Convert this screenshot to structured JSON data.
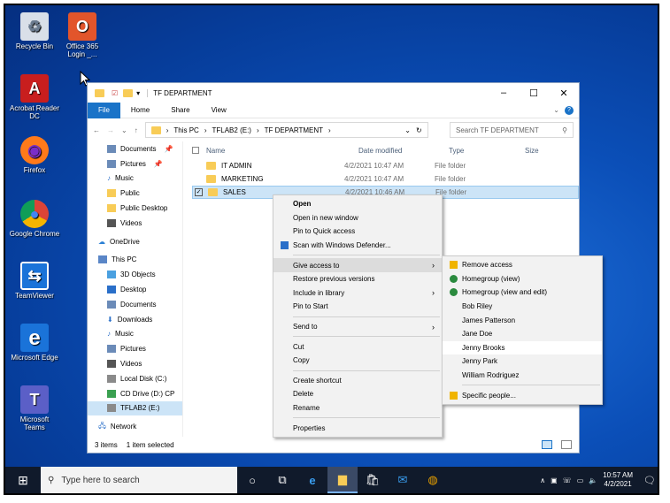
{
  "desktop": {
    "icons": [
      {
        "label": "Recycle Bin",
        "glyph": "♻",
        "bg": "#d9dfe8",
        "fg": "#6b7b8f"
      },
      {
        "label": "Office 365 Login _...",
        "glyph": "O",
        "bg": "#e2552b",
        "fg": "#ffffff"
      },
      {
        "label": "Acrobat Reader DC",
        "glyph": "A",
        "bg": "#c81e1e",
        "fg": "#ffffff"
      },
      {
        "label": "Firefox",
        "glyph": "◉",
        "bg": "#ff7a1a",
        "fg": "#7a2dc8"
      },
      {
        "label": "Google Chrome",
        "glyph": "◍",
        "bg": "#ffffff",
        "fg": "#2a8a3e"
      },
      {
        "label": "TeamViewer",
        "glyph": "⇆",
        "bg": "#1a73d9",
        "fg": "#ffffff"
      },
      {
        "label": "Microsoft Edge",
        "glyph": "e",
        "bg": "#1a73d9",
        "fg": "#ffffff"
      },
      {
        "label": "Microsoft Teams",
        "glyph": "T",
        "bg": "#5b5fc7",
        "fg": "#ffffff"
      }
    ]
  },
  "explorer": {
    "title": "TF DEPARTMENT",
    "ribbon": {
      "file": "File",
      "home": "Home",
      "share": "Share",
      "view": "View"
    },
    "address": {
      "this_pc": "This PC",
      "drive": "TFLAB2 (E:)",
      "folder": "TF DEPARTMENT"
    },
    "search_placeholder": "Search TF DEPARTMENT",
    "nav": [
      {
        "label": "Documents",
        "color": "#6b8bb8"
      },
      {
        "label": "Pictures",
        "color": "#6b8bb8"
      },
      {
        "label": "Music",
        "color": "#2a6fc9"
      },
      {
        "label": "Public",
        "color": "#f8cc57"
      },
      {
        "label": "Public Desktop",
        "color": "#f8cc57"
      },
      {
        "label": "Videos",
        "color": "#555555"
      },
      {
        "label": "OneDrive",
        "color": "#2a7fd4"
      },
      {
        "label": "This PC",
        "color": "#5a86c7"
      },
      {
        "label": "3D Objects",
        "color": "#4aa0e0"
      },
      {
        "label": "Desktop",
        "color": "#2a6fc9"
      },
      {
        "label": "Documents",
        "color": "#6b8bb8"
      },
      {
        "label": "Downloads",
        "color": "#2a6fc9"
      },
      {
        "label": "Music",
        "color": "#2a6fc9"
      },
      {
        "label": "Pictures",
        "color": "#6b8bb8"
      },
      {
        "label": "Videos",
        "color": "#555555"
      },
      {
        "label": "Local Disk (C:)",
        "color": "#8a8a8a"
      },
      {
        "label": "CD Drive (D:) CP",
        "color": "#3aa050"
      },
      {
        "label": "TFLAB2 (E:)",
        "color": "#8a8a8a"
      },
      {
        "label": "Network",
        "color": "#2a6fc9"
      }
    ],
    "columns": {
      "name": "Name",
      "date": "Date modified",
      "type": "Type",
      "size": "Size"
    },
    "files": [
      {
        "name": "IT ADMIN",
        "date": "4/2/2021 10:47 AM",
        "type": "File folder"
      },
      {
        "name": "MARKETING",
        "date": "4/2/2021 10:47 AM",
        "type": "File folder"
      },
      {
        "name": "SALES",
        "date": "4/2/2021 10:46 AM",
        "type": "File folder"
      }
    ],
    "status": {
      "count": "3 items",
      "selected": "1 item selected"
    }
  },
  "context_menu": {
    "items": [
      "Open",
      "Open in new window",
      "Pin to Quick access",
      "Scan with Windows Defender...",
      "Give access to",
      "Restore previous versions",
      "Include in library",
      "Pin to Start",
      "Send to",
      "Cut",
      "Copy",
      "Create shortcut",
      "Delete",
      "Rename",
      "Properties"
    ]
  },
  "submenu": {
    "items": [
      "Remove access",
      "Homegroup (view)",
      "Homegroup (view and edit)",
      "Bob Riley",
      "James Patterson",
      "Jane Doe",
      "Jenny Brooks",
      "Jenny Park",
      "William Rodriguez",
      "Specific people..."
    ]
  },
  "taskbar": {
    "search_placeholder": "Type here to search",
    "time": "10:57 AM",
    "date": "4/2/2021"
  }
}
